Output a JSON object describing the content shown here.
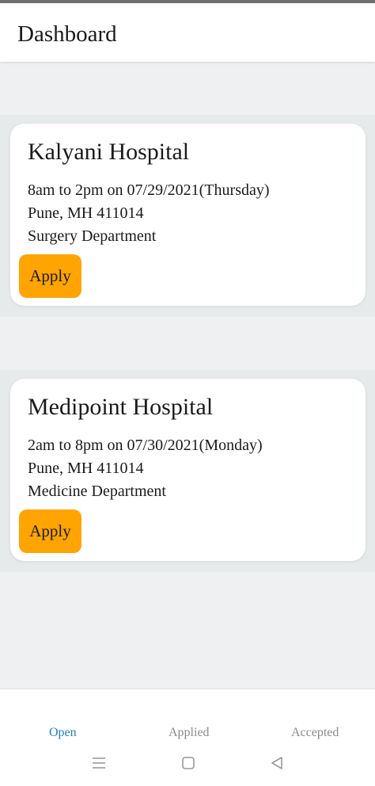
{
  "header": {
    "title": "Dashboard"
  },
  "cards": [
    {
      "hospital": "Kalyani Hospital",
      "schedule": "8am to 2pm on 07/29/2021(Thursday)",
      "location": "Pune, MH 411014",
      "department": "Surgery Department",
      "apply_label": "Apply"
    },
    {
      "hospital": "Medipoint Hospital",
      "schedule": "2am to 8pm on 07/30/2021(Monday)",
      "location": "Pune, MH 411014",
      "department": "Medicine Department",
      "apply_label": "Apply"
    }
  ],
  "tabs": [
    {
      "label": "Open",
      "active": true
    },
    {
      "label": "Applied",
      "active": false
    },
    {
      "label": "Accepted",
      "active": false
    }
  ],
  "colors": {
    "accent": "#ffa400",
    "active_tab": "#1f7fc6",
    "inactive_tab": "#8a8a8a",
    "background": "#eef0f1"
  },
  "system_nav": {
    "icons": [
      "menu-icon",
      "home-square-icon",
      "back-triangle-icon"
    ]
  }
}
